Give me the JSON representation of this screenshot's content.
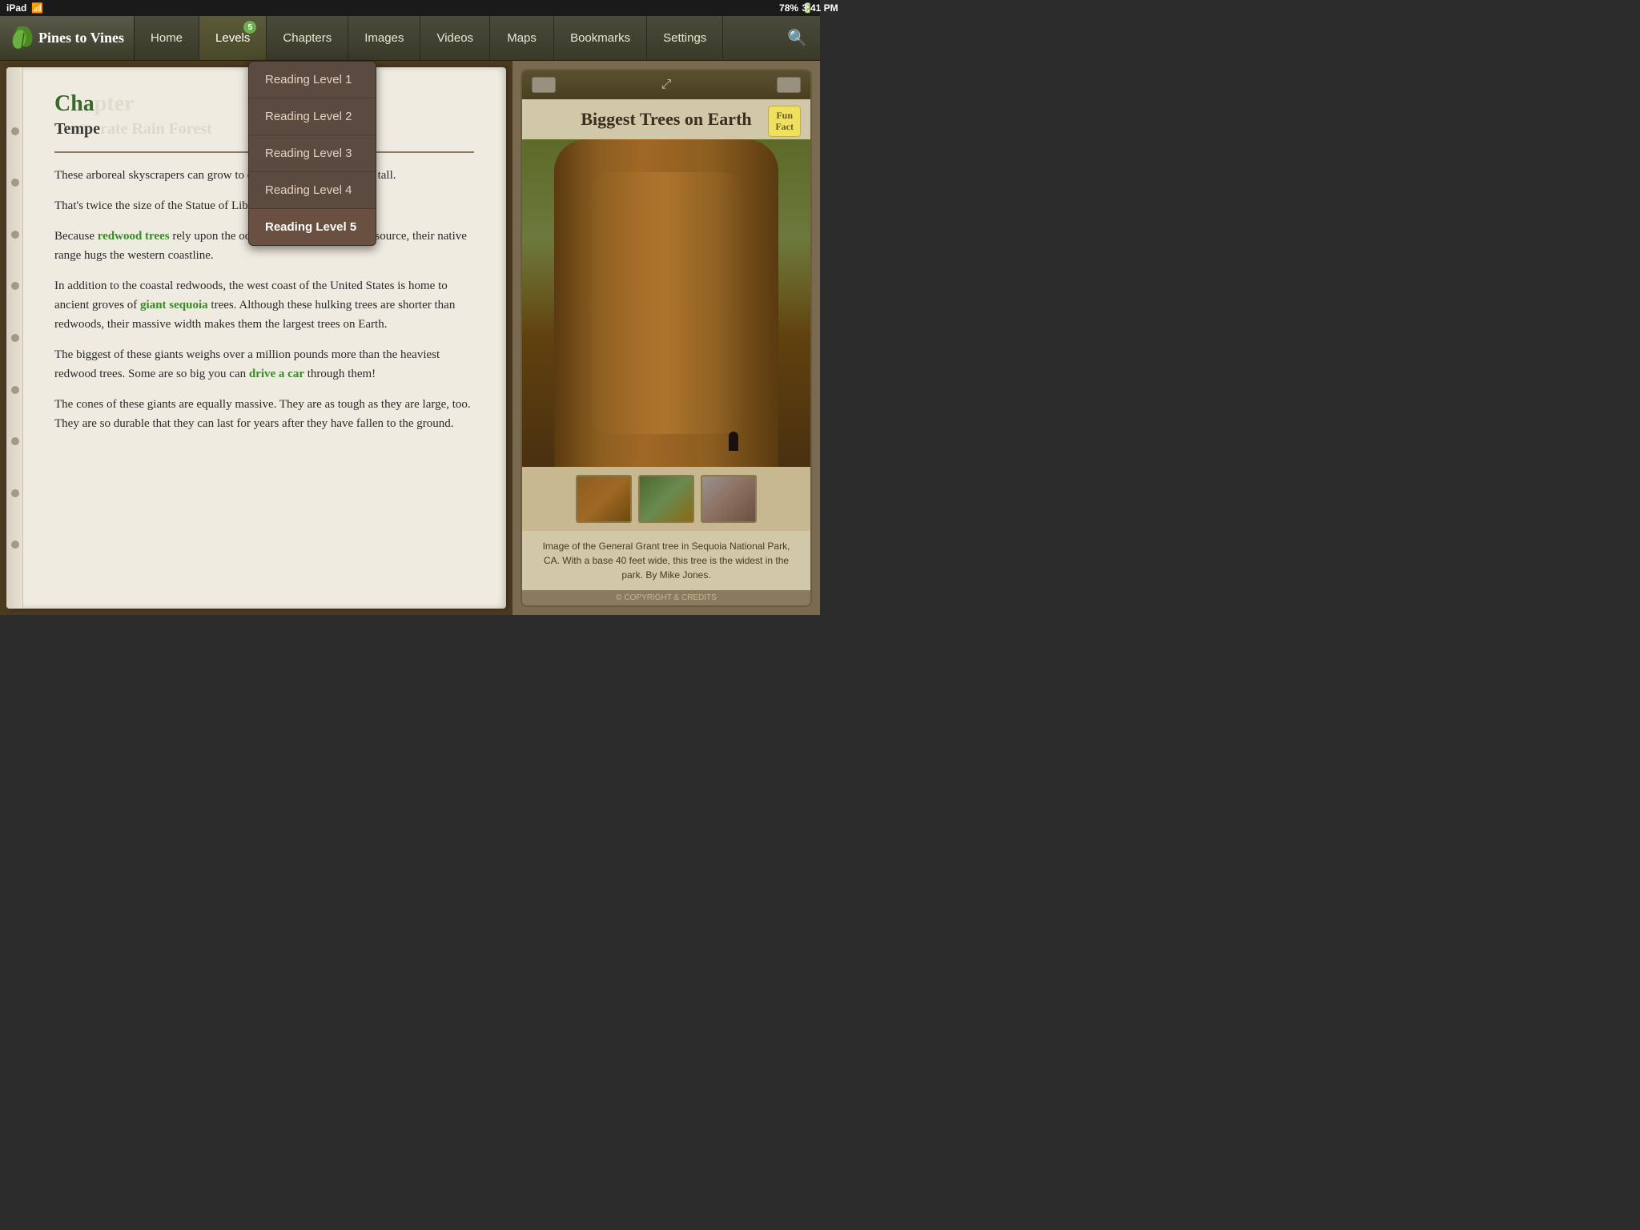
{
  "statusBar": {
    "device": "iPad",
    "wifi": "wifi",
    "time": "3:41 PM",
    "battery": "78%"
  },
  "appTitle": "Pines to Vines",
  "nav": {
    "items": [
      {
        "id": "home",
        "label": "Home",
        "badge": null
      },
      {
        "id": "levels",
        "label": "Levels",
        "badge": "5"
      },
      {
        "id": "chapters",
        "label": "Chapters",
        "badge": null
      },
      {
        "id": "images",
        "label": "Images",
        "badge": null
      },
      {
        "id": "videos",
        "label": "Videos",
        "badge": null
      },
      {
        "id": "maps",
        "label": "Maps",
        "badge": null
      },
      {
        "id": "bookmarks",
        "label": "Bookmarks",
        "badge": null
      },
      {
        "id": "settings",
        "label": "Settings",
        "badge": null
      }
    ],
    "searchIcon": "🔍"
  },
  "levelsDropdown": {
    "items": [
      {
        "id": "level1",
        "label": "Reading Level 1",
        "active": false
      },
      {
        "id": "level2",
        "label": "Reading Level 2",
        "active": false
      },
      {
        "id": "level3",
        "label": "Reading Level 3",
        "active": false
      },
      {
        "id": "level4",
        "label": "Reading Level 4",
        "active": false
      },
      {
        "id": "level5",
        "label": "Reading Level 5",
        "active": true
      }
    ]
  },
  "bookContent": {
    "chapterTitle": "Cha",
    "chapterSubtitle": "Tempe",
    "paragraphs": [
      "These arboreal skyscrapers can grow to over 400 feet (122 meters) tall.",
      "That's twice the size of the Statue of Liberty!",
      "Because redwood trees rely upon the ocean's sea spray as a water source, their native range hugs the western coastline.",
      "In addition to the coastal redwoods, the west coast of the United States is home to ancient groves of giant sequoia trees. Although these hulking trees are shorter than redwoods, their massive width makes them the largest trees on Earth.",
      "The biggest of these giants weighs over a million pounds more than the heaviest redwood trees. Some are so big you can drive a car through them!",
      "The cones of these giants are equally massive. They are as tough as they are large, too. They are so durable that they can last for years after they have fallen to the ground."
    ],
    "highlightedWords": [
      {
        "word": "redwood trees",
        "context": "paragraphs[2]"
      },
      {
        "word": "giant sequoia",
        "context": "paragraphs[3]"
      },
      {
        "word": "drive a car",
        "context": "paragraphs[4]"
      }
    ]
  },
  "imagePanel": {
    "title": "Biggest Trees on Earth",
    "funFact": {
      "line1": "Fun",
      "line2": "Fact"
    },
    "caption": "Image of the General Grant tree in Sequoia National Park, CA.  With a base 40 feet wide, this tree is the widest in the park.  By Mike Jones.",
    "copyright": "© COPYRIGHT & CREDITS",
    "thumbnails": [
      {
        "id": "thumb1",
        "alt": "Tree trunk close-up"
      },
      {
        "id": "thumb2",
        "alt": "Forest view"
      },
      {
        "id": "thumb3",
        "alt": "Snowy tree"
      }
    ]
  }
}
